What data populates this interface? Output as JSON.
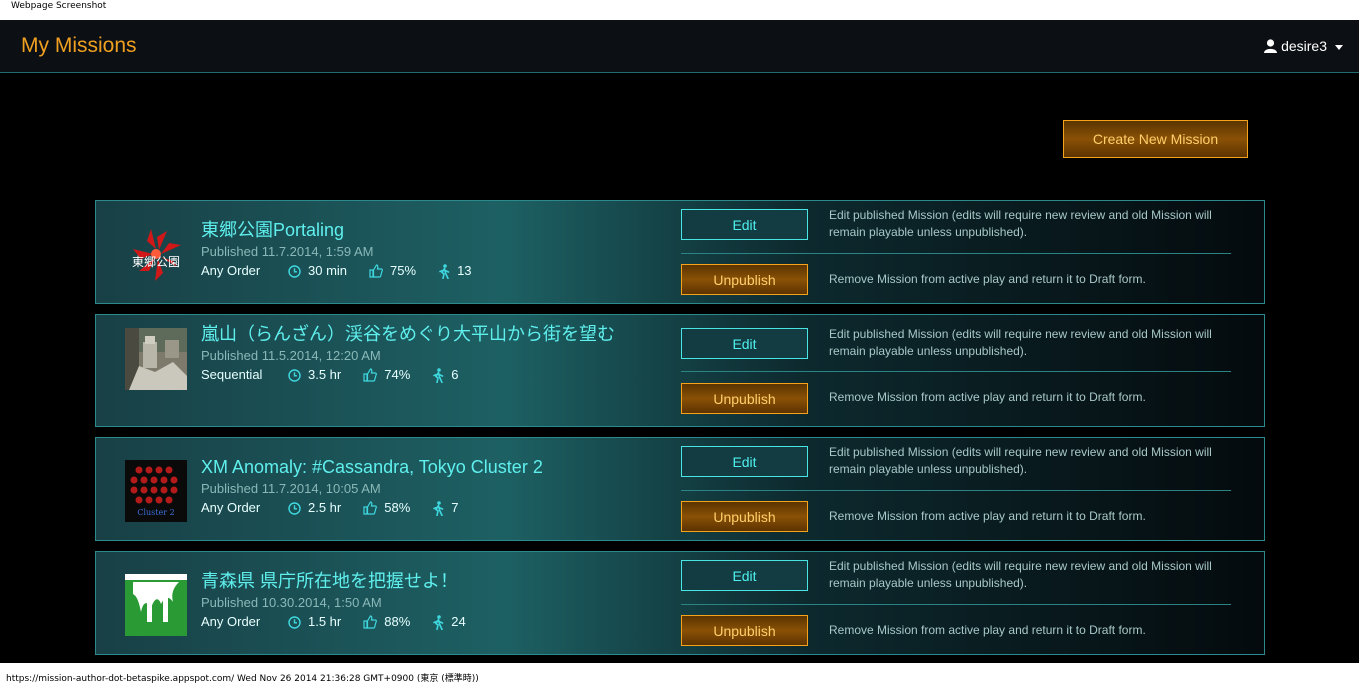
{
  "screenshot_label": "Webpage Screenshot",
  "navbar": {
    "brand": "My Missions",
    "user": "desire3"
  },
  "create_button": "Create New Mission",
  "missions": [
    {
      "title": "東郷公園Portaling",
      "published": "Published 11.7.2014, 1:59 AM",
      "order": "Any Order",
      "time": "30 min",
      "rating": "75%",
      "players": "13",
      "thumb_text": "東郷公園"
    },
    {
      "title": "嵐山（らんざん）渓谷をめぐり大平山から街を望む",
      "published": "Published 11.5.2014, 12:20 AM",
      "order": "Sequential",
      "time": "3.5 hr",
      "rating": "74%",
      "players": "6"
    },
    {
      "title": "XM Anomaly: #Cassandra, Tokyo Cluster 2",
      "published": "Published 11.7.2014, 10:05 AM",
      "order": "Any Order",
      "time": "2.5 hr",
      "rating": "58%",
      "players": "7",
      "thumb_text": "Cluster 2"
    },
    {
      "title": "青森県 県庁所在地を把握せよ！",
      "published": "Published 10.30.2014, 1:50 AM",
      "order": "Any Order",
      "time": "1.5 hr",
      "rating": "88%",
      "players": "24"
    }
  ],
  "actions": {
    "edit_label": "Edit",
    "edit_desc": "Edit published Mission (edits will require new review and old Mission will remain playable unless unpublished).",
    "unpublish_label": "Unpublish",
    "unpublish_desc": "Remove Mission from active play and return it to Draft form."
  },
  "footer": "https://mission-author-dot-betaspike.appspot.com/  Wed Nov 26 2014 21:36:28 GMT+0900 (東京 (標準時))",
  "colors": {
    "accent_orange": "#f7a21b",
    "accent_cyan": "#4ff0ef",
    "background": "#000000"
  }
}
